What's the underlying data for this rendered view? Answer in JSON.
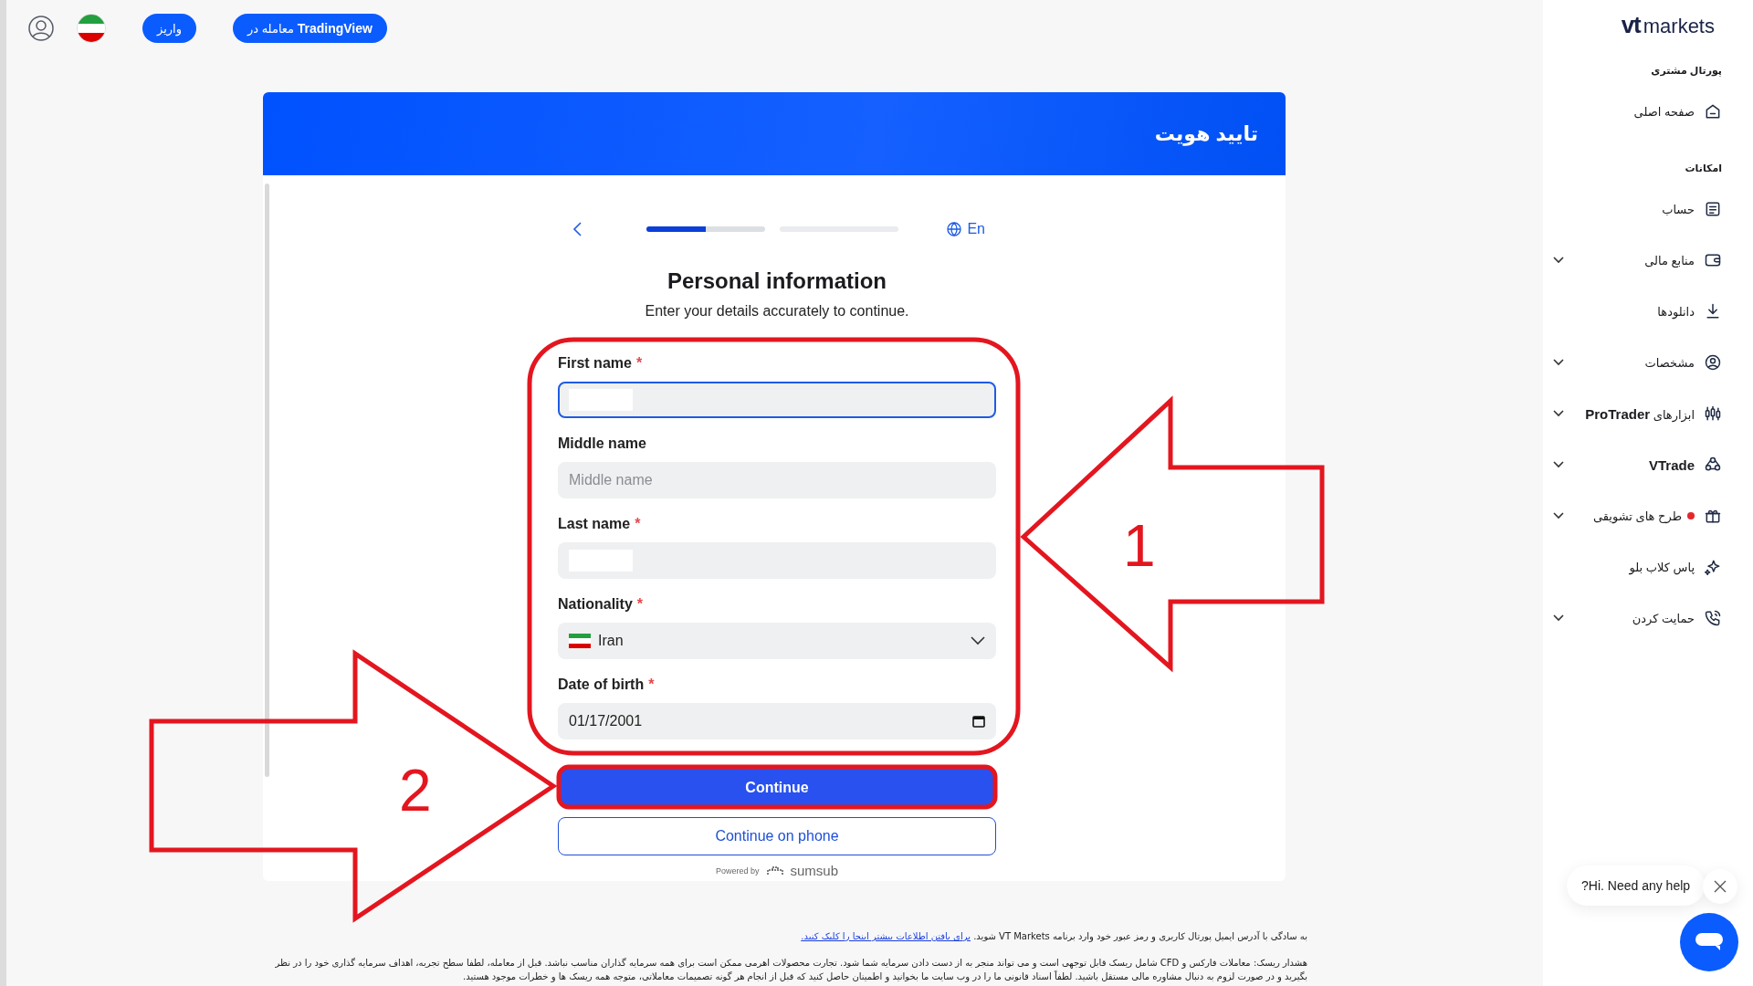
{
  "top_bar": {
    "trade_button": "معامله در **TradingView**",
    "deposit_button": "واریز"
  },
  "sidebar": {
    "logo": {
      "mark": "vt",
      "word": "markets"
    },
    "sections": [
      {
        "title": "پورتال مشتری",
        "items": [
          {
            "label": "صفحه اصلی",
            "emphasis": false,
            "expandable": false,
            "notification": false
          }
        ]
      },
      {
        "title": "امکانات",
        "items": [
          {
            "label": "حساب",
            "emphasis": false,
            "expandable": false,
            "notification": false
          },
          {
            "label": "منابع مالی",
            "emphasis": false,
            "expandable": true,
            "notification": false
          },
          {
            "label": "دانلودها",
            "emphasis": false,
            "expandable": false,
            "notification": false
          },
          {
            "label": "مشخصات",
            "emphasis": false,
            "expandable": true,
            "notification": false
          },
          {
            "label": "ابزارهای **ProTrader**",
            "emphasis": false,
            "expandable": true,
            "notification": false
          },
          {
            "label": "VTrade",
            "emphasis": true,
            "expandable": true,
            "notification": false
          },
          {
            "label": "طرح های تشویقی",
            "emphasis": false,
            "expandable": true,
            "notification": true
          },
          {
            "label": "پاس کلاب بلو",
            "emphasis": false,
            "expandable": false,
            "notification": false
          },
          {
            "label": "حمایت کردن",
            "emphasis": false,
            "expandable": true,
            "notification": false
          }
        ]
      }
    ]
  },
  "card": {
    "header_title": "تایید هویت",
    "stepper": {
      "steps": [
        {
          "active": true,
          "level": 0.5
        },
        {
          "active": false
        }
      ],
      "language": "En"
    },
    "heading": "Personal information",
    "subtitle": "Enter your details accurately to continue.",
    "fields": [
      {
        "kind": "text",
        "label": "First name",
        "required_mark": "*",
        "focused": true,
        "redacted": true
      },
      {
        "kind": "text",
        "label": "Middle name",
        "focused": false,
        "redacted": false,
        "placeholder": "Middle name"
      },
      {
        "kind": "text",
        "label": "Last name",
        "required_mark": "*",
        "focused": false,
        "redacted": true
      },
      {
        "kind": "select",
        "label": "Nationality",
        "required_mark": "*",
        "focused": false,
        "redacted": false,
        "value": "Iran"
      },
      {
        "kind": "date",
        "label": "Date of birth",
        "required_mark": "*",
        "focused": false,
        "redacted": false,
        "value": "01/17/2001"
      }
    ],
    "buttons": [
      {
        "kind": "primary",
        "label": "Continue"
      },
      {
        "kind": "secondary",
        "label": "Continue on phone"
      }
    ],
    "powered_by": {
      "prefix": "Powered by",
      "brand": "sumsub"
    }
  },
  "annotations": [
    {
      "label": "1"
    },
    {
      "label": "2"
    }
  ],
  "footer": {
    "intro": "به سادگی با آدرس ایمیل پورتال کاربری و رمز عبور خود وارد برنامه VT Markets شوید.",
    "link": "برای یافتن اطلاعات بیشتر اینجا را کلیک کنید.",
    "risk": "هشدار ریسک: معاملات فارکس و CFD شامل ریسک قابل توجهی است و می تواند منجر به از دست دادن سرمایه شما شود. تجارت محصولات اهرمی ممکن است برای همه سرمایه گذاران مناسب نباشد. قبل از معامله، لطفا سطح تجربه، اهداف سرمایه گذاری خود را در نظر بگیرید و در صورت لزوم به دنبال مشاوره مالی مستقل باشید. لطفاً اسناد قانونی ما را در وب سایت ما بخوانید و اطمینان حاصل کنید که قبل از انجام هر گونه تصمیمات معاملاتی، متوجه همه ریسک ها و خطرات موجود هستید."
  },
  "chat": {
    "bubble": "?Hi. Need any help"
  }
}
